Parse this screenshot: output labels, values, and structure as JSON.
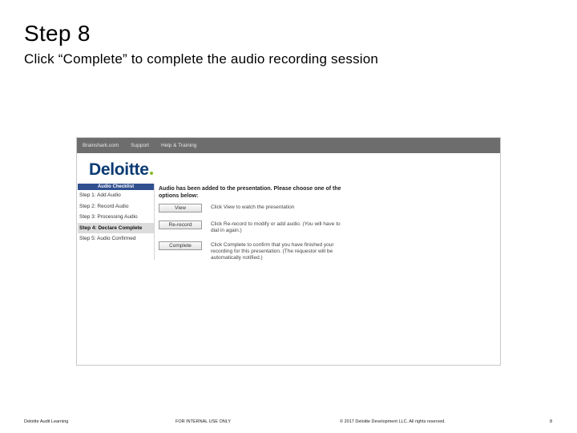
{
  "slide": {
    "title": "Step 8",
    "subtitle": "Click “Complete” to complete the audio recording session"
  },
  "app": {
    "topbar": [
      "Brainshark.com",
      "Support",
      "Help & Training"
    ],
    "logo": "Deloitte",
    "checklist": {
      "header": "Audio Checklist",
      "items": [
        "Step 1: Add Audio",
        "Step 2: Record Audio",
        "Step 3: Processing Audio",
        "Step 4: Declare Complete",
        "Step 5: Audio Confirmed"
      ],
      "active_index": 3
    },
    "panel": {
      "heading": "Audio has been added to the presentation. Please choose one of the options below:",
      "options": [
        {
          "button": "View",
          "description": "Click View to watch the presentation"
        },
        {
          "button": "Re-record",
          "description": "Click Re-record to modify or add audio. (You will have to dial in again.)"
        },
        {
          "button": "Complete",
          "description": "Click Complete to confirm that you have finished your recording for this presentation. (The requestor will be automatically notified.)"
        }
      ]
    }
  },
  "footer": {
    "left": "Deloitte Audit Learning",
    "center": "FOR INTERNAL USE ONLY",
    "right": "© 2017 Deloitte Development LLC. All rights reserved.",
    "page": "8"
  },
  "colors": {
    "topbar": "#6d6d6d",
    "logo": "#0a3a73",
    "logo_dot": "#86bc25",
    "checklist_header": "#2f4f8f"
  }
}
